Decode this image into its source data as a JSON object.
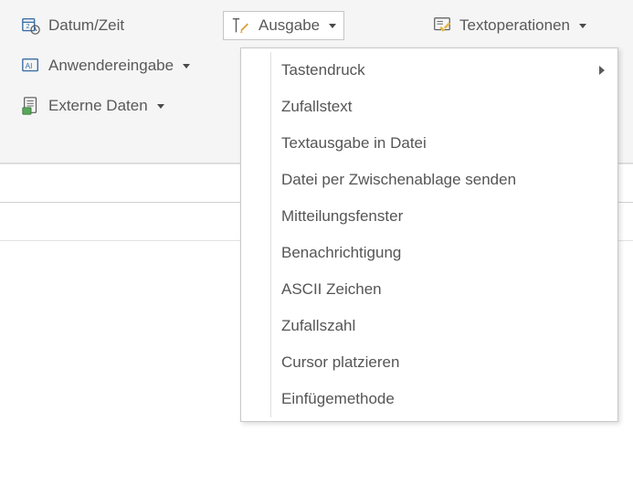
{
  "toolbar": {
    "col1": [
      {
        "label": "Datum/Zeit",
        "icon": "calendar-clock-icon",
        "hasCaret": false,
        "active": false
      },
      {
        "label": "Anwendereingabe",
        "icon": "user-input-icon",
        "hasCaret": true,
        "active": false
      },
      {
        "label": "Externe Daten",
        "icon": "external-data-icon",
        "hasCaret": true,
        "active": false
      }
    ],
    "col2": [
      {
        "label": "Ausgabe",
        "icon": "output-icon",
        "hasCaret": true,
        "active": true
      }
    ],
    "col3": [
      {
        "label": "Textoperationen",
        "icon": "text-operations-icon",
        "hasCaret": true,
        "active": false
      }
    ]
  },
  "dropdown": {
    "items": [
      {
        "label": "Tastendruck",
        "hasSubmenu": true
      },
      {
        "label": "Zufallstext",
        "hasSubmenu": false
      },
      {
        "label": "Textausgabe in Datei",
        "hasSubmenu": false
      },
      {
        "label": "Datei per Zwischenablage senden",
        "hasSubmenu": false
      },
      {
        "label": "Mitteilungsfenster",
        "hasSubmenu": false
      },
      {
        "label": "Benachrichtigung",
        "hasSubmenu": false
      },
      {
        "label": "ASCII Zeichen",
        "hasSubmenu": false
      },
      {
        "label": "Zufallszahl",
        "hasSubmenu": false
      },
      {
        "label": "Cursor platzieren",
        "hasSubmenu": false
      },
      {
        "label": "Einfügemethode",
        "hasSubmenu": false
      }
    ]
  }
}
